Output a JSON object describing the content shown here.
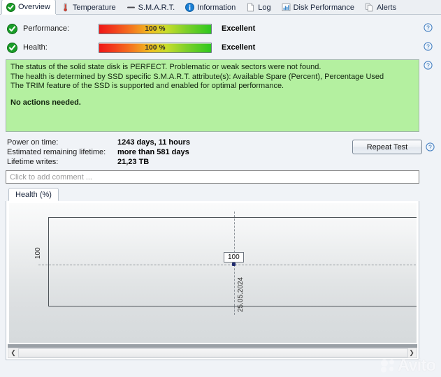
{
  "tabs": [
    {
      "label": "Overview",
      "icon": "green-check-icon",
      "active": true
    },
    {
      "label": "Temperature",
      "icon": "thermometer-icon",
      "active": false
    },
    {
      "label": "S.M.A.R.T.",
      "icon": "dash-icon",
      "active": false
    },
    {
      "label": "Information",
      "icon": "info-circle-icon",
      "active": false
    },
    {
      "label": "Log",
      "icon": "document-icon",
      "active": false
    },
    {
      "label": "Disk Performance",
      "icon": "bar-chart-icon",
      "active": false
    },
    {
      "label": "Alerts",
      "icon": "copy-pages-icon",
      "active": false
    }
  ],
  "status_rows": [
    {
      "label": "Performance:",
      "percent": "100 %",
      "verdict": "Excellent",
      "icon": "green-check-icon",
      "help": "help-icon"
    },
    {
      "label": "Health:",
      "percent": "100 %",
      "verdict": "Excellent",
      "icon": "green-check-icon",
      "help": "help-icon"
    }
  ],
  "message_panel": {
    "help": "help-icon",
    "lines": [
      "The status of the solid state disk is PERFECT. Problematic or weak sectors were not found.",
      "The health is determined by SSD specific S.M.A.R.T. attribute(s):  Available Spare (Percent), Percentage Used",
      "The TRIM feature of the SSD is supported and enabled for optimal performance."
    ],
    "action_line": "No actions needed."
  },
  "stats": [
    {
      "key": "Power on time:",
      "value": "1243 days, 11 hours"
    },
    {
      "key": "Estimated remaining lifetime:",
      "value": "more than 581 days"
    },
    {
      "key": "Lifetime writes:",
      "value": "21,23 TB"
    }
  ],
  "repeat_button": {
    "label": "Repeat Test",
    "help": "help-icon"
  },
  "comment_box": {
    "placeholder": "Click to add comment ..."
  },
  "chart_tab": {
    "label": "Health (%)"
  },
  "chart_toolbar": {
    "save_icon": "floppy-save-icon"
  },
  "scrollbar": {
    "left_arrow": "chevron-left-icon",
    "right_arrow": "chevron-right-icon"
  },
  "watermark": {
    "text": "Avito"
  },
  "colors": {
    "bar_start": "#f01818",
    "bar_end": "#2ec81e",
    "panel_green": "#b4f0a0",
    "accent_blue": "#2b6cb0",
    "check_green": "#1a9e28"
  },
  "chart_data": {
    "type": "line",
    "title": "Health (%)",
    "xlabel": "",
    "ylabel": "",
    "x": [
      "25.05.2024"
    ],
    "values": [
      100
    ],
    "point_labels": [
      "100"
    ],
    "ytick_labels": [
      "100"
    ],
    "xtick_labels": [
      "25.05.2024"
    ],
    "grid": true,
    "legend": "none",
    "series": [
      {
        "name": "Health (%)",
        "values": [
          100
        ]
      }
    ]
  }
}
